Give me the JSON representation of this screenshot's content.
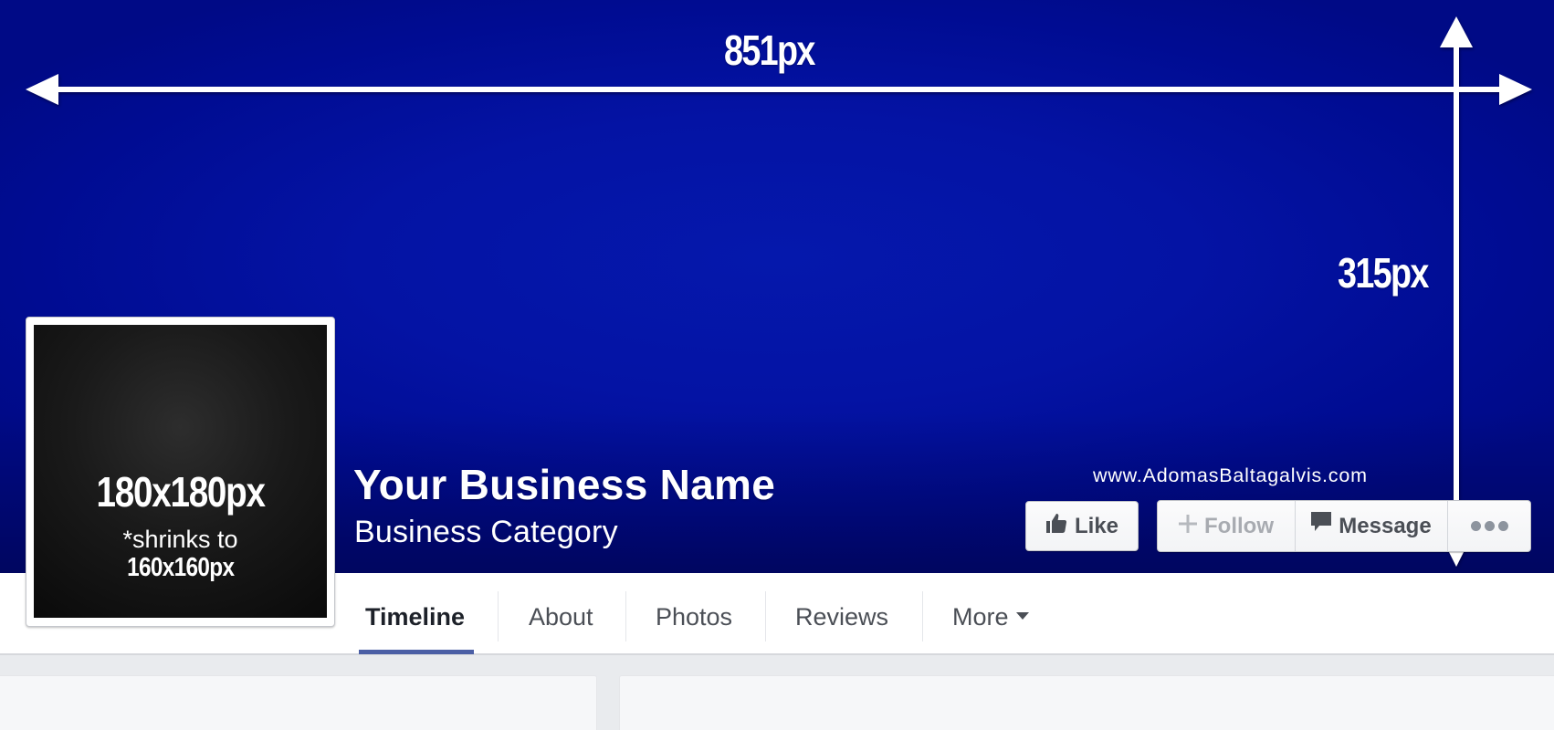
{
  "cover": {
    "width_label": "851px",
    "height_label": "315px",
    "watermark": "www.AdomasBaltagalvis.com",
    "background_color": "#0514a8"
  },
  "profile": {
    "size_label": "180x180px",
    "shrink_note": "*shrinks to",
    "shrink_size": "160x160px"
  },
  "page": {
    "name": "Your Business Name",
    "category": "Business Category"
  },
  "actions": {
    "like": {
      "label": "Like",
      "icon": "thumbs-up-icon"
    },
    "follow": {
      "label": "Follow",
      "icon": "plus-icon",
      "state": "disabled"
    },
    "message": {
      "label": "Message",
      "icon": "speech-bubble-icon"
    },
    "more": {
      "icon": "ellipsis-icon"
    }
  },
  "nav": {
    "tabs": [
      {
        "label": "Timeline",
        "active": true
      },
      {
        "label": "About"
      },
      {
        "label": "Photos"
      },
      {
        "label": "Reviews"
      },
      {
        "label": "More",
        "has_dropdown": true
      }
    ],
    "accent_color": "#4b5fa5"
  }
}
